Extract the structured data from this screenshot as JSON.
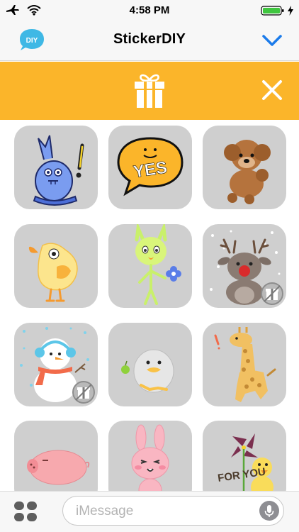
{
  "status_bar": {
    "time": "4:58 PM",
    "icons": [
      "airplane-mode-icon",
      "wifi-icon",
      "battery-icon",
      "charging-bolt-icon"
    ]
  },
  "nav": {
    "logo_text": "DIY",
    "title": "StickerDIY",
    "collapse_icon": "chevron-down-icon"
  },
  "banner": {
    "gift_icon": "gift-icon",
    "close_icon": "close-icon"
  },
  "stickers": [
    {
      "name": "blue-rabbit-exclaim",
      "locked": false
    },
    {
      "name": "yes-speech-bubble",
      "text": "YES",
      "locked": false
    },
    {
      "name": "brown-poodle",
      "locked": false
    },
    {
      "name": "yellow-chick",
      "locked": false
    },
    {
      "name": "green-alien-flower",
      "locked": false
    },
    {
      "name": "reindeer-snow",
      "locked": true
    },
    {
      "name": "snowman-scarf",
      "locked": true
    },
    {
      "name": "duck-with-apple",
      "locked": false
    },
    {
      "name": "giraffe",
      "locked": false
    },
    {
      "name": "pink-pig",
      "locked": false
    },
    {
      "name": "pink-bunny",
      "locked": false
    },
    {
      "name": "chick-pinwheel-for-you",
      "text": "FOR YOU",
      "locked": false
    }
  ],
  "input": {
    "placeholder": "iMessage",
    "apps_icon": "app-drawer-icon",
    "mic_icon": "microphone-icon"
  },
  "colors": {
    "accent": "#fbb52a",
    "ios_blue": "#1b7bea",
    "tile": "#cfcfcf"
  }
}
